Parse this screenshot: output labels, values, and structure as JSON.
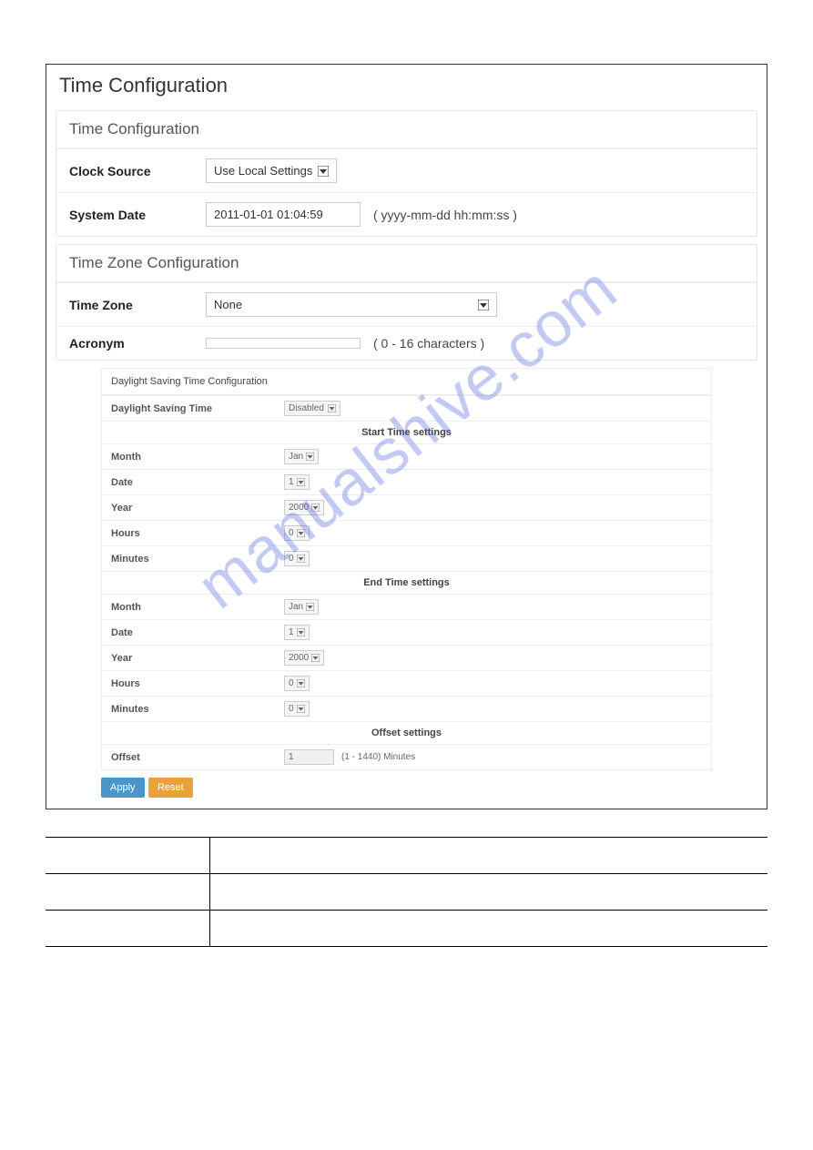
{
  "page": {
    "title": "Time Configuration"
  },
  "timeConfig": {
    "heading": "Time Configuration",
    "clockSource": {
      "label": "Clock Source",
      "value": "Use Local Settings"
    },
    "systemDate": {
      "label": "System Date",
      "value": "2011-01-01 01:04:59",
      "hint": "( yyyy-mm-dd hh:mm:ss )"
    }
  },
  "timeZone": {
    "heading": "Time Zone Configuration",
    "tz": {
      "label": "Time Zone",
      "value": "None"
    },
    "acronym": {
      "label": "Acronym",
      "value": "",
      "hint": "( 0 - 16 characters )"
    }
  },
  "dst": {
    "heading": "Daylight Saving Time Configuration",
    "mode": {
      "label": "Daylight Saving Time",
      "value": "Disabled"
    },
    "startHead": "Start Time settings",
    "endHead": "End Time settings",
    "offsetHead": "Offset settings",
    "start": {
      "month": {
        "label": "Month",
        "value": "Jan"
      },
      "date": {
        "label": "Date",
        "value": "1"
      },
      "year": {
        "label": "Year",
        "value": "2000"
      },
      "hours": {
        "label": "Hours",
        "value": "0"
      },
      "minutes": {
        "label": "Minutes",
        "value": "0"
      }
    },
    "end": {
      "month": {
        "label": "Month",
        "value": "Jan"
      },
      "date": {
        "label": "Date",
        "value": "1"
      },
      "year": {
        "label": "Year",
        "value": "2000"
      },
      "hours": {
        "label": "Hours",
        "value": "0"
      },
      "minutes": {
        "label": "Minutes",
        "value": "0"
      }
    },
    "offset": {
      "label": "Offset",
      "value": "1",
      "hint": "(1 - 1440) Minutes"
    },
    "apply": "Apply",
    "reset": "Reset"
  },
  "watermark": "manualshive.com"
}
